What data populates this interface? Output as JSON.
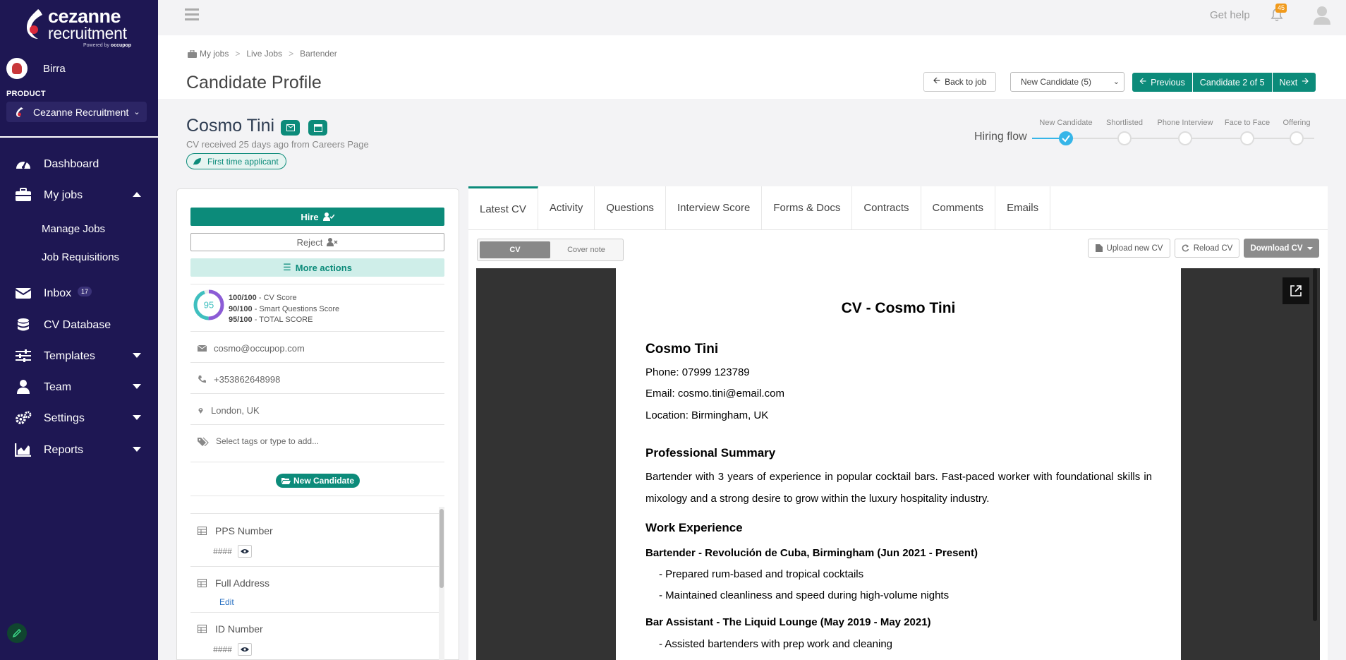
{
  "brand": {
    "word1": "cezanne",
    "word2": "recruitment",
    "powered_by": "Powered by",
    "powered_by_brand": "occupop"
  },
  "account": {
    "name": "Birra"
  },
  "product": {
    "label": "PRODUCT",
    "selected": "Cezanne Recruitment"
  },
  "sidebar": {
    "items": [
      {
        "label": "Dashboard",
        "icon": "dashboard-icon"
      },
      {
        "label": "My jobs",
        "icon": "briefcase-icon",
        "expanded": true
      },
      {
        "label": "Inbox",
        "icon": "envelope-icon",
        "badge": "17"
      },
      {
        "label": "CV Database",
        "icon": "database-icon"
      },
      {
        "label": "Templates",
        "icon": "sliders-icon"
      },
      {
        "label": "Team",
        "icon": "user-icon"
      },
      {
        "label": "Settings",
        "icon": "gears-icon"
      },
      {
        "label": "Reports",
        "icon": "chart-icon"
      }
    ],
    "sub_items": [
      "Manage Jobs",
      "Job Requisitions"
    ]
  },
  "topbar": {
    "get_help": "Get help",
    "notifications": "45"
  },
  "breadcrumb": [
    "My jobs",
    "Live Jobs",
    "Bartender"
  ],
  "page_title": "Candidate Profile",
  "header_actions": {
    "back_label": "Back to job",
    "stage_select": "New Candidate (5)",
    "previous_label": "Previous",
    "candidate_position": "Candidate 2 of 5",
    "next_label": "Next"
  },
  "candidate": {
    "name": "Cosmo Tini",
    "cv_received": "CV received 25 days ago from Careers Page",
    "first_time_badge": "First time applicant",
    "email": "cosmo@occupop.com",
    "phone": "+353862648998",
    "location": "London, UK",
    "tags_placeholder": "Select tags or type to add...",
    "stage": "New Candidate"
  },
  "hiring_flow": {
    "label": "Hiring flow",
    "steps": [
      "New Candidate",
      "Shortlisted",
      "Phone Interview",
      "Face to Face",
      "Offering"
    ],
    "current_index": 0,
    "color_done": "#36b5e8"
  },
  "actions": {
    "hire": "Hire",
    "reject": "Reject",
    "more": "More actions"
  },
  "scores": {
    "ring_value": "95",
    "cv_score": "100/100",
    "cv_score_label": " - CV Score",
    "questions_score": "90/100",
    "questions_score_label": " - Smart Questions Score",
    "total_score": "95/100",
    "total_score_label": " - TOTAL SCORE"
  },
  "custom_fields": [
    {
      "label": "PPS Number",
      "value": "####"
    },
    {
      "label": "Full Address",
      "action": "Edit"
    },
    {
      "label": "ID Number",
      "value": "####"
    }
  ],
  "tabs": [
    "Latest CV",
    "Activity",
    "Questions",
    "Interview Score",
    "Forms & Docs",
    "Contracts",
    "Comments",
    "Emails"
  ],
  "cv_toolbar": {
    "toggle_on": "CV",
    "toggle_off": "Cover note",
    "upload": "Upload new CV",
    "reload": "Reload CV",
    "download": "Download CV"
  },
  "cv_document": {
    "title": "CV - Cosmo Tini",
    "name": "Cosmo Tini",
    "phone": "Phone: 07999 123789",
    "email": "Email: cosmo.tini@email.com",
    "location": "Location: Birmingham, UK",
    "summary_heading": "Professional Summary",
    "summary": "Bartender with 3 years of experience in popular cocktail bars. Fast-paced worker with foundational skills in mixology and a strong desire to grow within the luxury hospitality industry.",
    "experience_heading": "Work Experience",
    "job1_title": "Bartender - Revolución de Cuba, Birmingham (Jun 2021 - Present)",
    "job1_points": [
      "- Prepared rum-based and tropical cocktails",
      "- Maintained cleanliness and speed during high-volume nights"
    ],
    "job2_title": "Bar Assistant - The Liquid Lounge (May 2019 - May 2021)",
    "job2_points": [
      "- Assisted bartenders with prep work and cleaning"
    ]
  },
  "colors": {
    "sidebar": "#1e1753",
    "accent": "#0c8b7a",
    "notification": "#f19a1b"
  }
}
